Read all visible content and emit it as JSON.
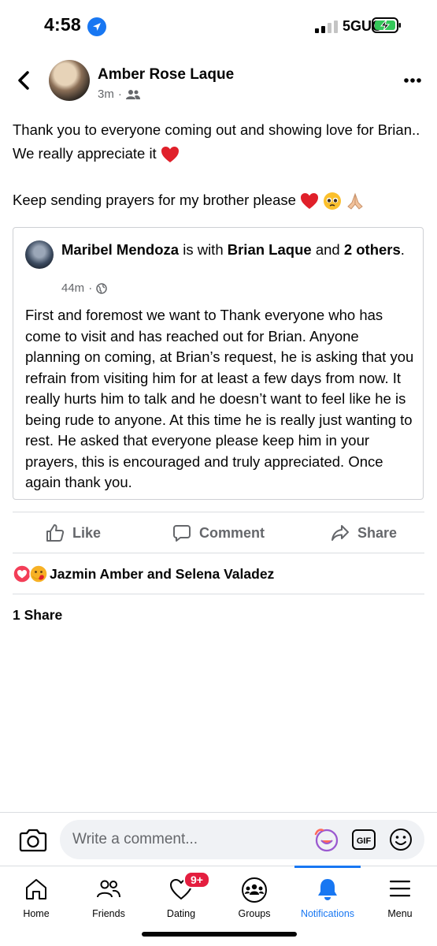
{
  "status": {
    "time": "4:58",
    "network": "5GUC"
  },
  "post": {
    "author": "Amber Rose Laque",
    "time": "3m",
    "line1": "Thank you to everyone coming out and showing love for Brian.. We really appreciate it",
    "line2": "Keep sending prayers for my brother please"
  },
  "shared": {
    "author": "Maribel Mendoza",
    "with_text": "is with",
    "tagged": "Brian Laque",
    "and_text": "and",
    "others": "2 others",
    "time": "44m",
    "body": "First and foremost we want to Thank everyone who has come to visit and has reached out for Brian. Anyone planning on coming, at Brian’s request, he is asking that you  refrain from visiting him for at least a few days from now. It really hurts him to talk and he doesn’t want to feel like he is being rude to anyone. At this time he is really just wanting to rest. He asked that everyone please keep him in your prayers, this is encouraged and truly appreciated. Once again thank you."
  },
  "actions": {
    "like": "Like",
    "comment": "Comment",
    "share": "Share"
  },
  "reactions": {
    "names": "Jazmin Amber and Selena Valadez"
  },
  "shares": "1 Share",
  "composer": {
    "placeholder": "Write a comment...",
    "gif": "GIF"
  },
  "nav": {
    "home": "Home",
    "friends": "Friends",
    "dating": "Dating",
    "groups": "Groups",
    "notifications": "Notifications",
    "menu": "Menu",
    "dating_badge": "9+"
  },
  "colors": {
    "accent": "#1877f2",
    "secondary_text": "#65676b",
    "badge": "#e41e3f"
  }
}
